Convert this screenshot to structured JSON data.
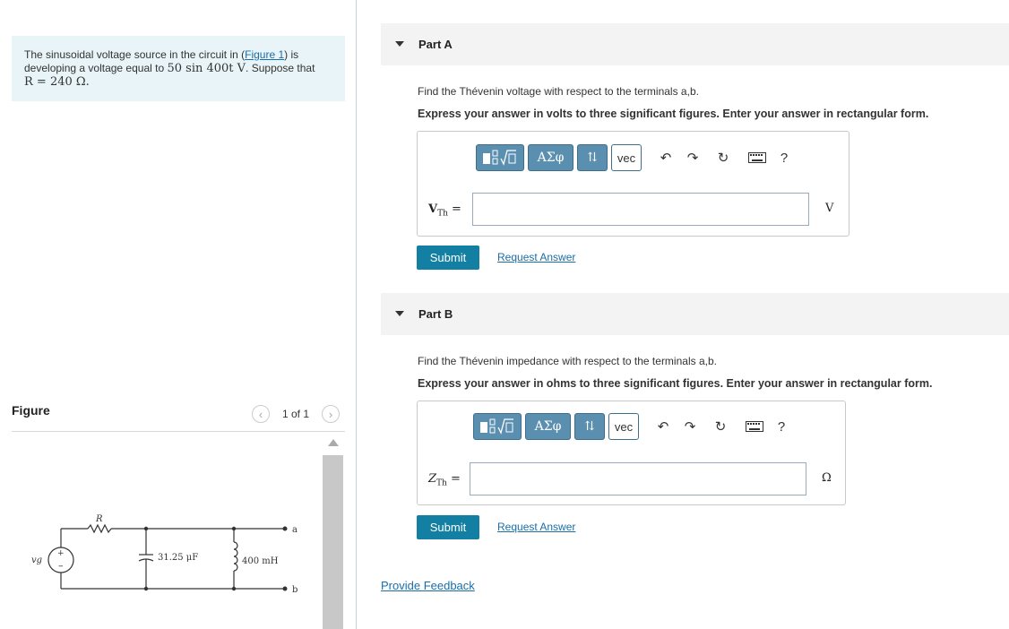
{
  "problem": {
    "text_prefix": "The sinusoidal voltage source in the circuit in (",
    "figure_link": "Figure 1",
    "text_mid": ") is developing a voltage equal to ",
    "voltage_expr": "50 sin 400t V",
    "text_suppose": ". Suppose that",
    "resistance": "R = 240 Ω."
  },
  "figure": {
    "title": "Figure",
    "counter": "1 of 1",
    "prev_icon": "chevron-left-icon",
    "next_icon": "chevron-right-icon",
    "circuit": {
      "source_label": "vg",
      "resistor_label": "R",
      "capacitor_label": "31.25 μF",
      "inductor_label": "400 mH",
      "terminal_a": "a",
      "terminal_b": "b"
    }
  },
  "parts": [
    {
      "title": "Part A",
      "question": "Find the Thévenin voltage with respect to the terminals a,b.",
      "instruction": "Express your answer in volts to three significant figures. Enter your answer in rectangular form.",
      "variable": "V",
      "variable_sub": "Th",
      "equals": "=",
      "unit": "V",
      "input_value": "",
      "submit_label": "Submit",
      "request_label": "Request Answer"
    },
    {
      "title": "Part B",
      "question": "Find the Thévenin impedance with respect to the terminals a,b.",
      "instruction": "Express your answer in ohms to three significant figures. Enter your answer in rectangular form.",
      "variable": "Z",
      "variable_sub": "Th",
      "equals": "=",
      "unit": "Ω",
      "input_value": "",
      "submit_label": "Submit",
      "request_label": "Request Answer"
    }
  ],
  "toolbar": {
    "templates_icon": "templates-icon",
    "greek_label": "ΑΣφ",
    "updown_icon": "updown-arrows-icon",
    "vec_label": "vec",
    "undo_icon": "undo-icon",
    "redo_icon": "redo-icon",
    "reset_icon": "reset-icon",
    "keyboard_icon": "keyboard-icon",
    "help_label": "?"
  },
  "footer": {
    "feedback_label": "Provide Feedback"
  },
  "colors": {
    "accent": "#127fa3",
    "toolbar_button": "#5b8fb0",
    "problem_bg": "#e8f4f8",
    "link": "#1a6ea8"
  }
}
